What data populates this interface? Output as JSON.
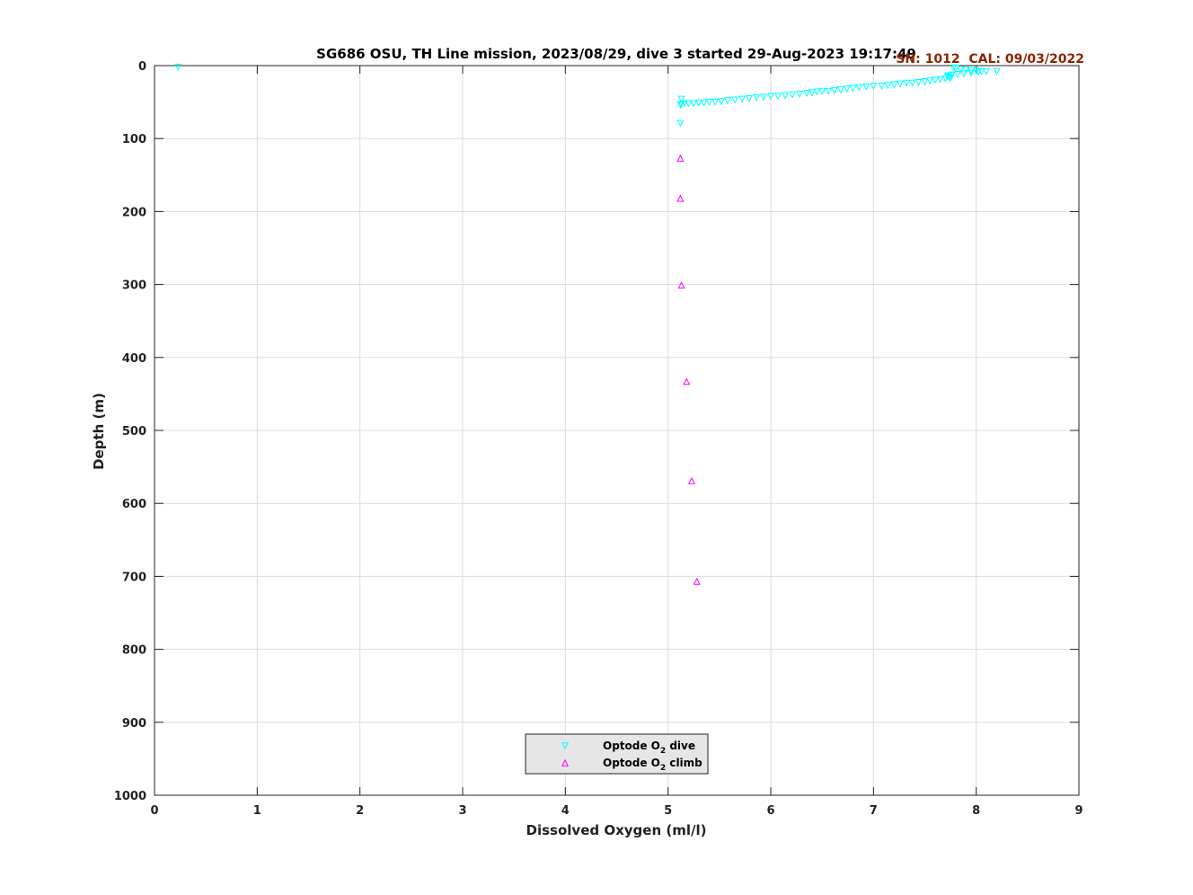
{
  "chart_data": {
    "type": "scatter",
    "title": "SG686 OSU, TH Line mission, 2023/08/29, dive 3 started 29-Aug-2023 19:17:49",
    "annotation": "SN: 1012  CAL: 09/03/2022",
    "xlabel": "Dissolved Oxygen (ml/l)",
    "ylabel": "Depth (m)",
    "xlim": [
      0,
      9
    ],
    "ylim": [
      0,
      1000
    ],
    "y_reversed": true,
    "grid": true,
    "xticks": [
      0,
      1,
      2,
      3,
      4,
      5,
      6,
      7,
      8,
      9
    ],
    "yticks": [
      0,
      100,
      200,
      300,
      400,
      500,
      600,
      700,
      800,
      900,
      1000
    ],
    "legend_position": "bottom-center",
    "colors": {
      "dive": "#00ffff",
      "climb": "#ff00ff",
      "annotation": "#8b2500",
      "legend_bg": "#e6e6e6"
    },
    "series": [
      {
        "name": "Optode O2 dive",
        "legend_main": "Optode O",
        "legend_sub": "2",
        "legend_rest": " dive",
        "marker": "triangle-down",
        "x": [
          0.23,
          7.78,
          7.8,
          7.85,
          7.9,
          7.95,
          8.0,
          8.05,
          8.1,
          8.2,
          8.02,
          7.95,
          7.88,
          7.82,
          7.76,
          7.73,
          7.72,
          7.74,
          7.75,
          7.7,
          7.65,
          7.6,
          7.55,
          7.5,
          7.44,
          7.38,
          7.32,
          7.26,
          7.2,
          7.14,
          7.08,
          7.0,
          6.93,
          6.86,
          6.8,
          6.74,
          6.68,
          6.62,
          6.56,
          6.5,
          6.45,
          6.4,
          6.35,
          6.28,
          6.21,
          6.14,
          6.07,
          6.0,
          5.93,
          5.86,
          5.79,
          5.72,
          5.65,
          5.58,
          5.52,
          5.46,
          5.4,
          5.35,
          5.3,
          5.25,
          5.2,
          5.16,
          5.13,
          5.12,
          5.13,
          5.12
        ],
        "y": [
          2,
          3,
          4,
          5,
          6,
          7,
          7,
          8,
          8,
          8,
          9,
          10,
          11,
          12,
          13,
          14,
          15,
          16,
          17,
          18,
          19,
          20,
          21,
          22,
          23,
          24,
          24,
          25,
          26,
          27,
          28,
          28,
          29,
          30,
          31,
          32,
          33,
          34,
          35,
          35,
          36,
          37,
          38,
          39,
          40,
          41,
          42,
          42,
          43,
          44,
          45,
          46,
          47,
          48,
          49,
          50,
          50,
          51,
          51,
          52,
          52,
          52,
          53,
          54,
          46,
          79
        ]
      },
      {
        "name": "Optode O2 climb",
        "legend_main": "Optode O",
        "legend_sub": "2",
        "legend_rest": " climb",
        "marker": "triangle-up",
        "x": [
          5.12,
          5.12,
          5.13,
          5.18,
          5.23,
          5.28
        ],
        "y": [
          127,
          182,
          301,
          433,
          569,
          707
        ]
      }
    ]
  }
}
